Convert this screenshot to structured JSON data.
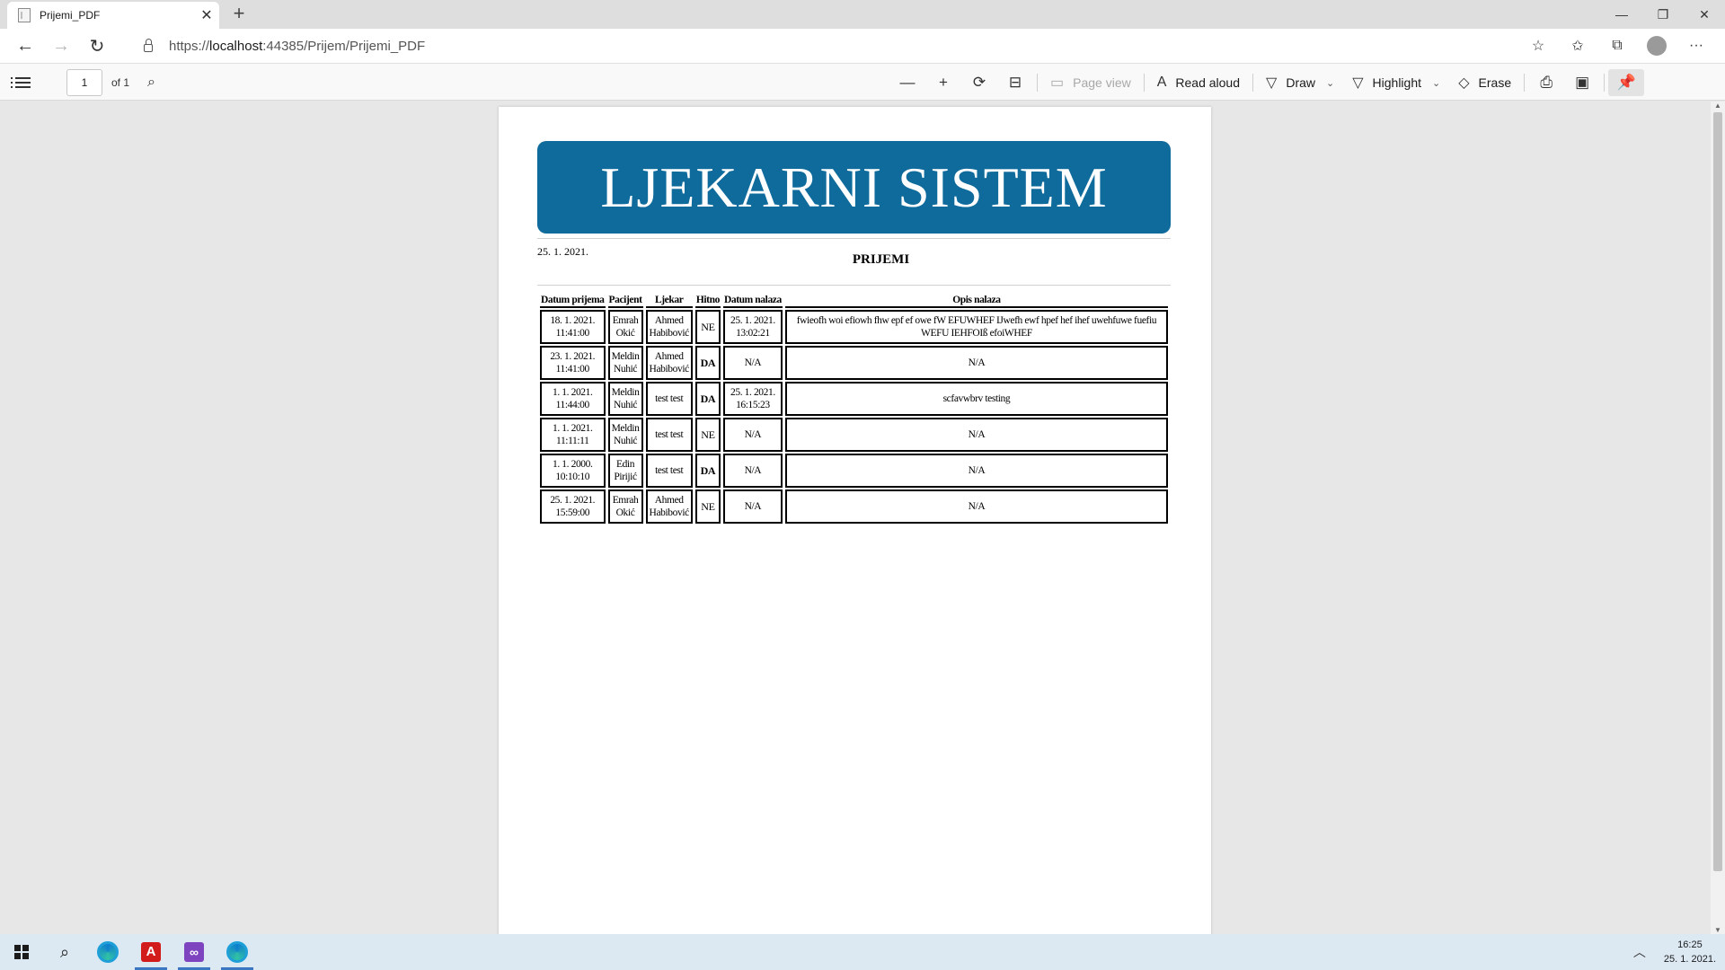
{
  "browser": {
    "tab_title": "Prijemi_PDF",
    "tab_close": "✕",
    "new_tab": "+",
    "url_scheme": "https://",
    "url_host": "localhost",
    "url_rest": ":44385/Prijem/Prijemi_PDF"
  },
  "pdf_toolbar": {
    "page_number": "1",
    "page_of": "of 1",
    "page_view": "Page view",
    "read_aloud": "Read aloud",
    "draw": "Draw",
    "highlight": "Highlight",
    "erase": "Erase"
  },
  "document": {
    "banner": "LJEKARNI SISTEM",
    "date": "25. 1. 2021.",
    "title": "PRIJEMI",
    "columns": [
      "Datum prijema",
      "Pacijent",
      "Ljekar",
      "Hitno",
      "Datum nalaza",
      "Opis nalaza"
    ],
    "rows": [
      {
        "datum_prijema": "18. 1. 2021. 11:41:00",
        "pacijent": "Emrah Okić",
        "ljekar": "Ahmed Habibović",
        "hitno": "NE",
        "datum_nalaza": "25. 1. 2021. 13:02:21",
        "opis": "fwieofh woi efiowh fhw epf ef owe fW EFUWHEF IJwefh ewf hpef hef ihef uwehfuwe fuefiu WEFU IEHFOIß efoiWHEF"
      },
      {
        "datum_prijema": "23. 1. 2021. 11:41:00",
        "pacijent": "Meldin Nuhić",
        "ljekar": "Ahmed Habibović",
        "hitno": "DA",
        "datum_nalaza": "N/A",
        "opis": "N/A"
      },
      {
        "datum_prijema": "1. 1. 2021. 11:44:00",
        "pacijent": "Meldin Nuhić",
        "ljekar": "test test",
        "hitno": "DA",
        "datum_nalaza": "25. 1. 2021. 16:15:23",
        "opis": "scfavwbrv testing"
      },
      {
        "datum_prijema": "1. 1. 2021. 11:11:11",
        "pacijent": "Meldin Nuhić",
        "ljekar": "test test",
        "hitno": "NE",
        "datum_nalaza": "N/A",
        "opis": "N/A"
      },
      {
        "datum_prijema": "1. 1. 2000. 10:10:10",
        "pacijent": "Edin Pirijić",
        "ljekar": "test test",
        "hitno": "DA",
        "datum_nalaza": "N/A",
        "opis": "N/A"
      },
      {
        "datum_prijema": "25. 1. 2021. 15:59:00",
        "pacijent": "Emrah Okić",
        "ljekar": "Ahmed Habibović",
        "hitno": "NE",
        "datum_nalaza": "N/A",
        "opis": "N/A"
      }
    ]
  },
  "taskbar": {
    "time": "16:25",
    "date": "25. 1. 2021."
  },
  "colors": {
    "banner": "#0f6b9c",
    "taskbar": "#dce9f3"
  }
}
